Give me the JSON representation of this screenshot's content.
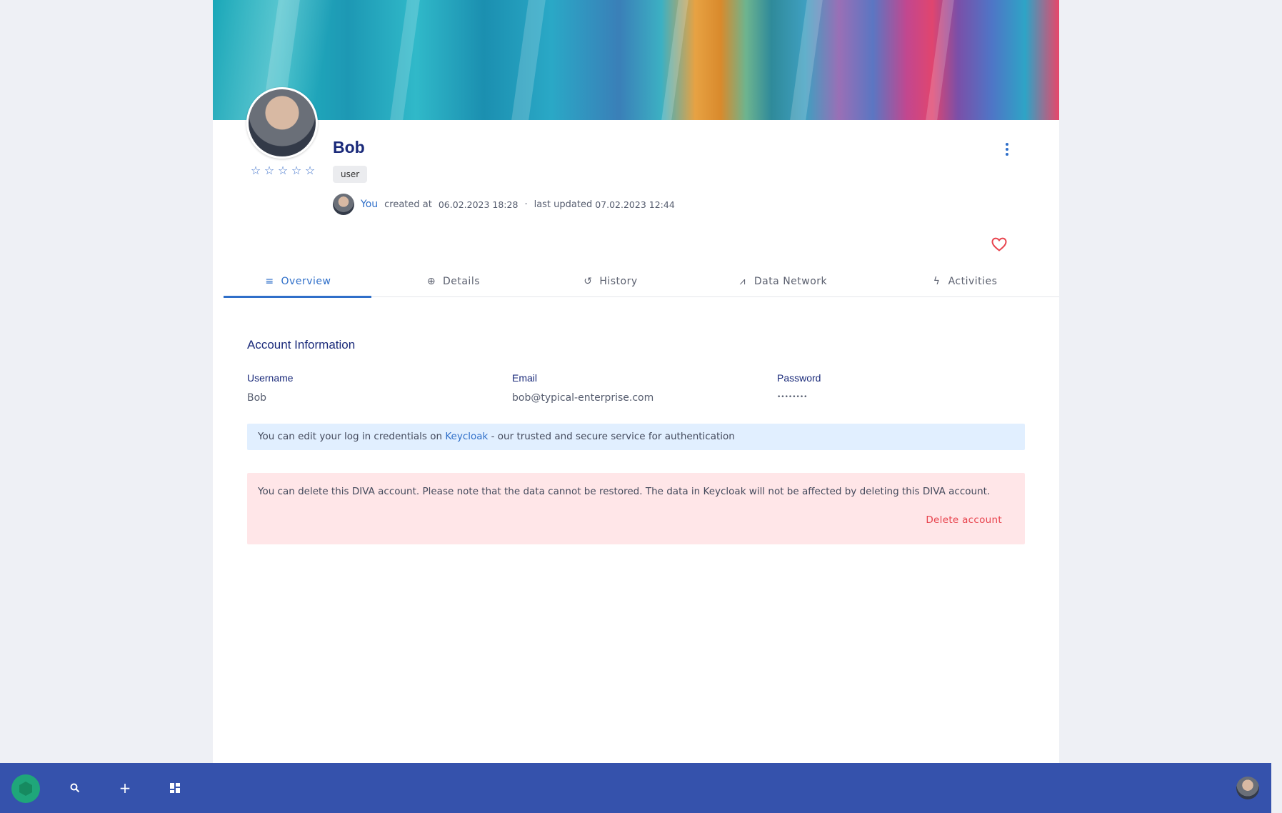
{
  "profile": {
    "name": "Bob",
    "role": "user",
    "rating_stars": 5,
    "star_glyph": "☆",
    "meta": {
      "you": "You",
      "created_label": "created at",
      "created_at": "06.02.2023 18:28",
      "separator": "·",
      "updated_label": "last updated",
      "updated_at": "07.02.2023 12:44"
    }
  },
  "tabs": [
    {
      "label": "Overview",
      "icon": "overview-icon"
    },
    {
      "label": "Details",
      "icon": "details-icon"
    },
    {
      "label": "History",
      "icon": "history-icon"
    },
    {
      "label": "Data Network",
      "icon": "data-network-icon"
    },
    {
      "label": "Activities",
      "icon": "activities-icon"
    }
  ],
  "account": {
    "title": "Account Information",
    "username_label": "Username",
    "username": "Bob",
    "email_label": "Email",
    "email": "bob@typical-enterprise.com",
    "password_label": "Password",
    "password": "••••••••",
    "info_prefix": "You can edit your log in credentials on ",
    "info_link": "Keycloak",
    "info_suffix": " - our trusted and secure service for authentication",
    "delete_notice": "You can delete this DIVA account. Please note that the data cannot be restored. The data in Keycloak will not be affected by deleting this DIVA account.",
    "delete_button": "Delete account"
  },
  "colors": {
    "accent": "#2f6fc9",
    "bottombar": "#3552ac",
    "danger": "#e8434d"
  }
}
